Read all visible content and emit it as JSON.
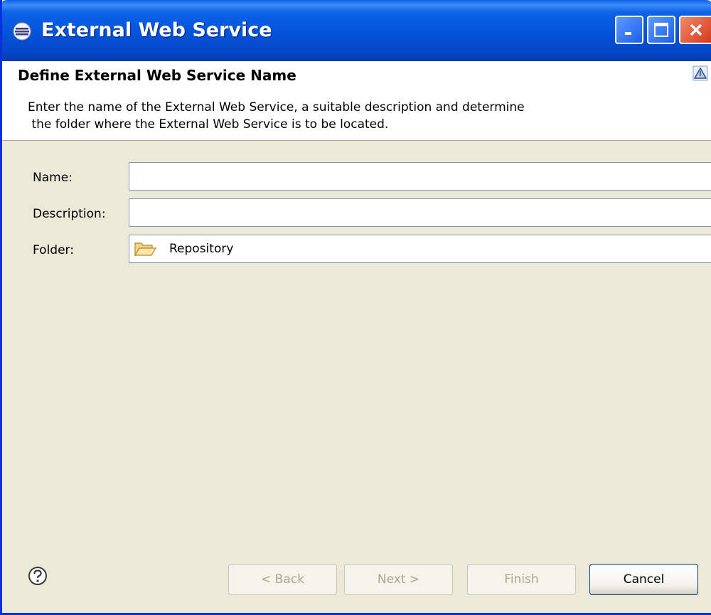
{
  "window": {
    "title": "External Web Service"
  },
  "header": {
    "title": "Define External Web Service Name",
    "description": "Enter the name of the External Web Service, a suitable description and determine\n the folder where the External Web Service is to be located."
  },
  "form": {
    "name_label": "Name:",
    "name_value": "",
    "description_label": "Description:",
    "description_value": "",
    "folder_label": "Folder:",
    "folder_value": "Repository"
  },
  "buttons": {
    "back": "< Back",
    "next": "Next >",
    "finish": "Finish",
    "cancel": "Cancel"
  },
  "colors": {
    "titlebar": "#0453d8",
    "dialog_background": "#ece9d8",
    "close_button": "#d6381a"
  }
}
